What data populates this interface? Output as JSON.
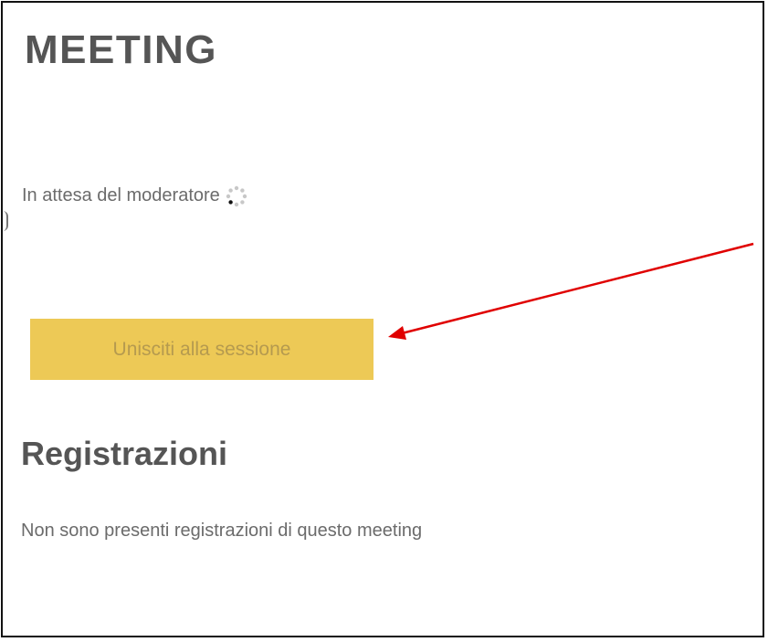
{
  "meeting": {
    "title": "MEETING",
    "status_text": "In attesa del moderatore"
  },
  "join": {
    "label": "Unisciti alla sessione"
  },
  "recordings": {
    "title": "Registrazioni",
    "empty_text": "Non sono presenti registrazioni di questo meeting"
  },
  "colors": {
    "button": "#edc956",
    "button_text": "#b59a4f",
    "annotation_arrow": "#e00000",
    "heading": "#555555",
    "body_text": "#6b6b6b"
  },
  "icons": {
    "loading": "loading-spinner-icon",
    "annotation": "red-arrow"
  }
}
